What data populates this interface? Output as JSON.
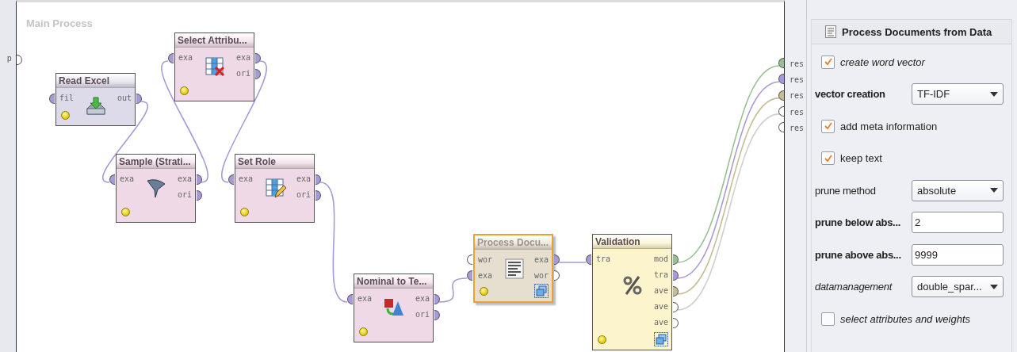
{
  "process": {
    "title": "Main Process",
    "input_ports": [
      {
        "label": "p",
        "color": "#ffffff"
      }
    ]
  },
  "operators": [
    {
      "name": "Read Excel",
      "kind": "reader",
      "color": "#dddbe9",
      "selected": false,
      "subprocess": false,
      "inputs": [
        {
          "label": "fil",
          "color": "#a89ad8"
        }
      ],
      "outputs": [
        {
          "label": "out",
          "color": "#a89ad8"
        }
      ]
    },
    {
      "name": "Select Attribu...",
      "kind": "remover",
      "color": "#efd9e6",
      "selected": false,
      "subprocess": false,
      "inputs": [
        {
          "label": "exa",
          "color": "#a89ad8"
        }
      ],
      "outputs": [
        {
          "label": "exa",
          "color": "#a89ad8"
        },
        {
          "label": "ori",
          "color": "#a89ad8"
        }
      ]
    },
    {
      "name": "Sample (Strati...",
      "kind": "funnel",
      "color": "#efd9e6",
      "selected": false,
      "subprocess": false,
      "inputs": [
        {
          "label": "exa",
          "color": "#a89ad8"
        }
      ],
      "outputs": [
        {
          "label": "exa",
          "color": "#a89ad8"
        },
        {
          "label": "ori",
          "color": "#a89ad8"
        }
      ]
    },
    {
      "name": "Set Role",
      "kind": "editor",
      "color": "#efd9e6",
      "selected": false,
      "subprocess": false,
      "inputs": [
        {
          "label": "exa",
          "color": "#a89ad8"
        }
      ],
      "outputs": [
        {
          "label": "exa",
          "color": "#a89ad8"
        },
        {
          "label": "ori",
          "color": "#a89ad8"
        }
      ]
    },
    {
      "name": "Nominal to Te...",
      "kind": "shapes",
      "color": "#efd9e6",
      "selected": false,
      "subprocess": false,
      "inputs": [
        {
          "label": "exa",
          "color": "#a89ad8"
        }
      ],
      "outputs": [
        {
          "label": "exa",
          "color": "#a89ad8"
        },
        {
          "label": "ori",
          "color": "#a89ad8"
        }
      ]
    },
    {
      "name": "Process Docu...",
      "kind": "document",
      "color": "#e6dfcf",
      "selected": true,
      "subprocess": true,
      "inputs": [
        {
          "label": "wor",
          "color": "#ffffff"
        },
        {
          "label": "exa",
          "color": "#a89ad8"
        }
      ],
      "outputs": [
        {
          "label": "exa",
          "color": "#a89ad8"
        },
        {
          "label": "wor",
          "color": "#ffffff"
        }
      ]
    },
    {
      "name": "Validation",
      "kind": "percent",
      "color": "#fbf4cc",
      "selected": false,
      "subprocess": true,
      "inputs": [
        {
          "label": "tra",
          "color": "#a89ad8"
        }
      ],
      "outputs": [
        {
          "label": "mod",
          "color": "#96c291"
        },
        {
          "label": "tra",
          "color": "#a89ad8"
        },
        {
          "label": "ave",
          "color": "#c6bd92"
        },
        {
          "label": "ave",
          "color": "#ffffff"
        },
        {
          "label": "ave",
          "color": "#ffffff"
        }
      ]
    }
  ],
  "results": [
    {
      "label": "res",
      "color": "#96c291"
    },
    {
      "label": "res",
      "color": "#a89ad8"
    },
    {
      "label": "res",
      "color": "#c6bd92"
    },
    {
      "label": "res",
      "color": "#ffffff"
    },
    {
      "label": "res",
      "color": "#ffffff"
    }
  ],
  "parameters": {
    "title": "Process Documents from Data",
    "items": [
      {
        "kind": "checkbox",
        "label": "create word vector",
        "checked": true
      },
      {
        "kind": "select",
        "label": "vector creation",
        "value": "TF-IDF"
      },
      {
        "kind": "checkbox",
        "label": "add meta information",
        "checked": true
      },
      {
        "kind": "checkbox",
        "label": "keep text",
        "checked": true
      },
      {
        "kind": "select",
        "label": "prune method",
        "value": "absolute"
      },
      {
        "kind": "text",
        "label": "prune below abs...",
        "value": "2"
      },
      {
        "kind": "text",
        "label": "prune above abs...",
        "value": "9999"
      },
      {
        "kind": "select",
        "label": "datamanagement",
        "value": "double_spar..."
      },
      {
        "kind": "checkbox",
        "label": "select attributes and weights",
        "checked": false
      }
    ]
  }
}
